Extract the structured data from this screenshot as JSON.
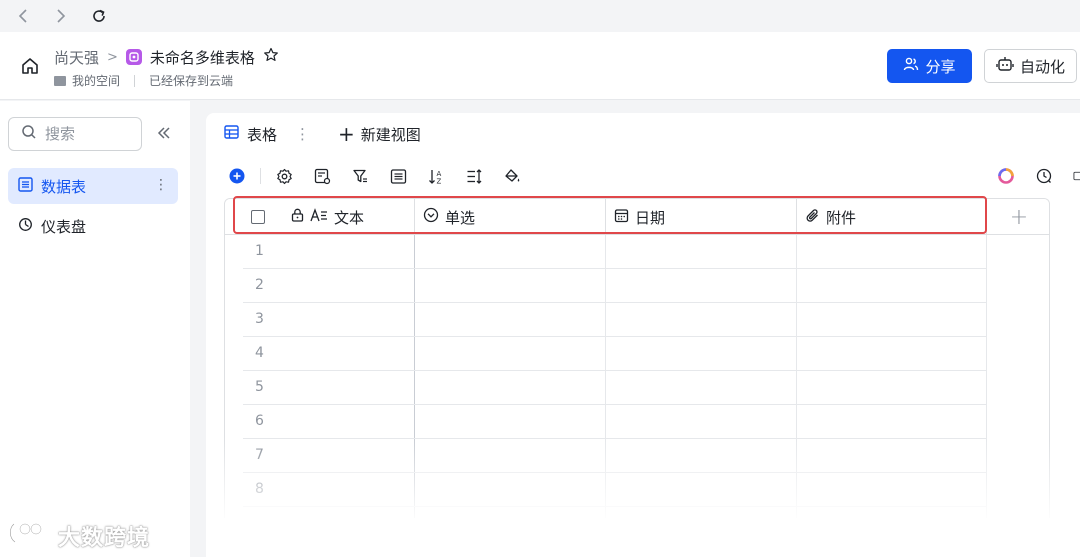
{
  "header": {
    "owner": "尚天强",
    "separator": ">",
    "doc_title": "未命名多维表格",
    "space": "我的空间",
    "save_status": "已经保存到云端",
    "share_label": "分享",
    "automation_label": "自动化"
  },
  "sidebar": {
    "search_placeholder": "搜索",
    "items": [
      {
        "label": "数据表"
      },
      {
        "label": "仪表盘"
      }
    ]
  },
  "tabs": {
    "active": "表格",
    "new_view": "新建视图"
  },
  "grid": {
    "columns": [
      {
        "label": "文本"
      },
      {
        "label": "单选"
      },
      {
        "label": "日期"
      },
      {
        "label": "附件"
      }
    ],
    "rows": [
      "1",
      "2",
      "3",
      "4",
      "5",
      "6",
      "7",
      "8"
    ]
  },
  "watermark": "大数跨境",
  "colors": {
    "accent": "#1456f0",
    "highlight": "#e0474a",
    "doc_icon": "#b659e8"
  }
}
